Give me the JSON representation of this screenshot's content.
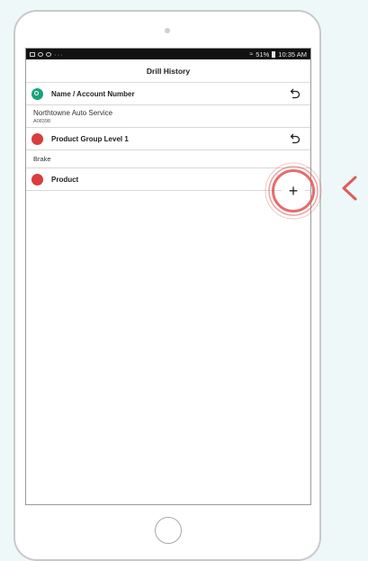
{
  "status_bar": {
    "left_icons": [
      "image-icon",
      "settings-icon",
      "app-icon"
    ],
    "dots": "···",
    "battery": "51%",
    "time": "10:35 AM"
  },
  "app": {
    "title": "Drill History"
  },
  "drill_levels": [
    {
      "label": "Name / Account Number",
      "indicator_color": "#1aa37a",
      "value": "Northtowne Auto Service",
      "sub_value": "A08398"
    },
    {
      "label": "Product Group Level 1",
      "indicator_color": "#d93d3d",
      "value": "Brake"
    },
    {
      "label": "Product",
      "indicator_color": "#d93d3d"
    }
  ],
  "icons": {
    "undo": "undo-icon",
    "add": "plus-icon",
    "pointer": "chevron-left-icon"
  },
  "colors": {
    "highlight": "#e05555",
    "pointer": "#e25a5a"
  },
  "add_symbol": "+"
}
